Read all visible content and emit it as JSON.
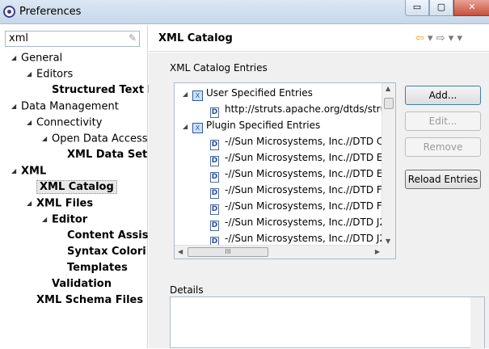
{
  "window": {
    "title": "Preferences",
    "controls": {
      "minimize": "▭",
      "maximize": "▢",
      "close": "✕"
    }
  },
  "left": {
    "filter_value": "xml",
    "tree": [
      {
        "label": "General",
        "level": 1,
        "toggle": "◢",
        "bold": false
      },
      {
        "label": "Editors",
        "level": 2,
        "toggle": "◢",
        "bold": false
      },
      {
        "label": "Structured Text E",
        "level": 3,
        "toggle": "",
        "bold": true
      },
      {
        "label": "Data Management",
        "level": 1,
        "toggle": "◢",
        "bold": false
      },
      {
        "label": "Connectivity",
        "level": 2,
        "toggle": "◢",
        "bold": false
      },
      {
        "label": "Open Data Access",
        "level": 3,
        "toggle": "◢",
        "bold": false
      },
      {
        "label": "XML Data Set",
        "level": 4,
        "toggle": "",
        "bold": true
      },
      {
        "label": "XML",
        "level": 1,
        "toggle": "◢",
        "bold": true
      },
      {
        "label": "XML Catalog",
        "level": 2,
        "toggle": "",
        "bold": true,
        "selected": true
      },
      {
        "label": "XML Files",
        "level": 2,
        "toggle": "◢",
        "bold": true
      },
      {
        "label": "Editor",
        "level": 3,
        "toggle": "◢",
        "bold": true
      },
      {
        "label": "Content Assis",
        "level": 4,
        "toggle": "",
        "bold": true
      },
      {
        "label": "Syntax Colori",
        "level": 4,
        "toggle": "",
        "bold": true
      },
      {
        "label": "Templates",
        "level": 4,
        "toggle": "",
        "bold": true
      },
      {
        "label": "Validation",
        "level": 3,
        "toggle": "",
        "bold": true
      },
      {
        "label": "XML Schema Files",
        "level": 2,
        "toggle": "",
        "bold": true
      }
    ]
  },
  "page": {
    "title": "XML Catalog",
    "nav": {
      "back": "⇦",
      "back_menu": "▾",
      "forward": "⇨",
      "forward_menu": "▾",
      "menu": "▾"
    },
    "entries_group": "XML Catalog Entries",
    "details_group": "Details",
    "entries": [
      {
        "label": "User Specified Entries",
        "kind": "category",
        "toggle": "◢",
        "icon_glyph": "X"
      },
      {
        "label": "http://struts.apache.org/dtds/stru",
        "kind": "dtd",
        "icon_glyph": "D"
      },
      {
        "label": "Plugin Specified Entries",
        "kind": "category",
        "toggle": "◢",
        "icon_glyph": "X"
      },
      {
        "label": "-//Sun Microsystems, Inc.//DTD C",
        "kind": "dtd",
        "icon_glyph": "D"
      },
      {
        "label": "-//Sun Microsystems, Inc.//DTD E",
        "kind": "dtd",
        "icon_glyph": "D"
      },
      {
        "label": "-//Sun Microsystems, Inc.//DTD E",
        "kind": "dtd",
        "icon_glyph": "D"
      },
      {
        "label": "-//Sun Microsystems, Inc.//DTD Fa",
        "kind": "dtd",
        "icon_glyph": "D"
      },
      {
        "label": "-//Sun Microsystems, Inc.//DTD Fa",
        "kind": "dtd",
        "icon_glyph": "D"
      },
      {
        "label": "-//Sun Microsystems, Inc.//DTD J2",
        "kind": "dtd",
        "icon_glyph": "D"
      },
      {
        "label": "-//Sun Microsystems, Inc.//DTD J2",
        "kind": "dtd",
        "icon_glyph": "D"
      }
    ],
    "scroll": {
      "up": "▲",
      "down": "▼",
      "left": "◀",
      "right": "▶",
      "grip": "III"
    },
    "buttons": {
      "add": "Add...",
      "edit": "Edit...",
      "remove": "Remove",
      "reload": "Reload Entries"
    }
  },
  "colors": {
    "accent": "#3c7fb1",
    "selection": "#e8e8e8"
  }
}
